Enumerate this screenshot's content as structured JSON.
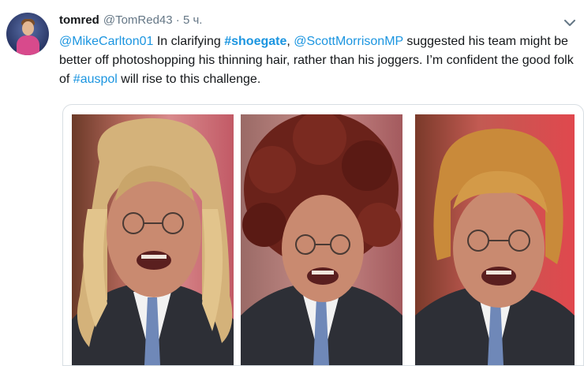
{
  "tweet": {
    "name": "tomred",
    "handle": "@TomRed43",
    "separator": "·",
    "time": "5 ч.",
    "text": {
      "mention1": "@MikeCarlton01",
      "t1": " In clarifying ",
      "hashtag1": "#shoegate",
      "t2": ", ",
      "mention2": "@ScottMorrisonMP",
      "t3": " suggested his team might be better off photoshopping his thinning hair, rather than his joggers. I’m confident the good folk of ",
      "hashtag2": "#auspol",
      "t4": " will rise to this challenge."
    }
  },
  "icons": {
    "menu": "chevron-down-icon",
    "avatar": "avatar"
  },
  "colors": {
    "link": "#1b95e0",
    "text": "#14171a",
    "muted": "#657786",
    "border": "#d8dee3"
  },
  "media": {
    "photos": [
      {
        "hair": "long blonde wig",
        "hair_color": "#c9a56a"
      },
      {
        "hair": "curly afro wig",
        "hair_color": "#6a221a"
      },
      {
        "hair": "ginger mop-top wig",
        "hair_color": "#c98a3a"
      }
    ]
  }
}
